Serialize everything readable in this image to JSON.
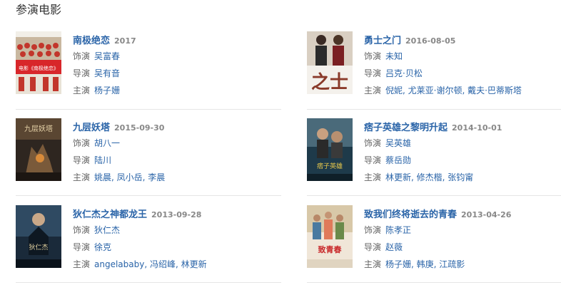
{
  "section": {
    "title": "参演电影"
  },
  "movies": [
    {
      "title": "南极绝恋",
      "date": "2017",
      "role_label": "饰演",
      "role": "吴富春",
      "director_label": "导演",
      "director": "吴有音",
      "cast_label": "主演",
      "cast": "杨子姗",
      "poster_text": "电影《南极绝恋》"
    },
    {
      "title": "勇士之门",
      "date": "2016-08-05",
      "role_label": "饰演",
      "role": "未知",
      "director_label": "导演",
      "director": "吕克·贝松",
      "cast_label": "主演",
      "cast": "倪妮, 尤莱亚·谢尔顿, 戴夫·巴蒂斯塔",
      "poster_text": "之士"
    },
    {
      "title": "九层妖塔",
      "date": "2015-09-30",
      "role_label": "饰演",
      "role": "胡八一",
      "director_label": "导演",
      "director": "陆川",
      "cast_label": "主演",
      "cast": "姚晨, 凤小岳, 李晨",
      "poster_text": "九层妖塔"
    },
    {
      "title": "痞子英雄之黎明升起",
      "date": "2014-10-01",
      "role_label": "饰演",
      "role": "吴英雄",
      "director_label": "导演",
      "director": "蔡岳勋",
      "cast_label": "主演",
      "cast": "林更新, 修杰楷, 张钧甯",
      "poster_text": "痞子英雄"
    },
    {
      "title": "狄仁杰之神都龙王",
      "date": "2013-09-28",
      "role_label": "饰演",
      "role": "狄仁杰",
      "director_label": "导演",
      "director": "徐克",
      "cast_label": "主演",
      "cast": "angelababy, 冯绍峰, 林更新",
      "poster_text": "狄仁杰"
    },
    {
      "title": "致我们终将逝去的青春",
      "date": "2013-04-26",
      "role_label": "饰演",
      "role": "陈孝正",
      "director_label": "导演",
      "director": "赵薇",
      "cast_label": "主演",
      "cast": "杨子姗, 韩庚, 江疏影",
      "poster_text": "致青春"
    }
  ]
}
